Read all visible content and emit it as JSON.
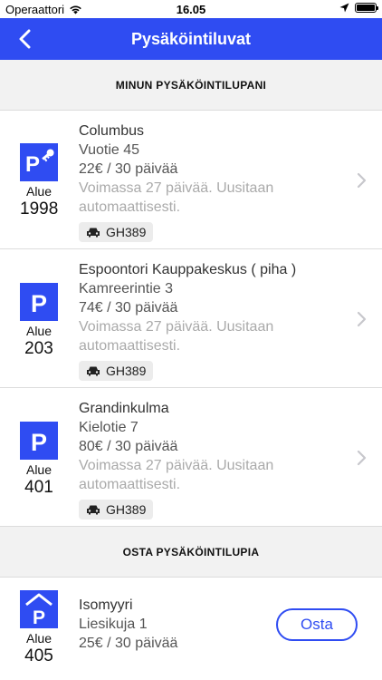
{
  "status_bar": {
    "carrier": "Operaattori",
    "time": "16.05"
  },
  "nav": {
    "title": "Pysäköintiluvat"
  },
  "colors": {
    "accent": "#2f4cf2"
  },
  "my_permits": {
    "header": "MINUN PYSÄKÖINTILUPANI",
    "items": [
      {
        "icon": "parking-key-icon",
        "zone_label": "Alue",
        "zone_number": "1998",
        "name": "Columbus",
        "address": "Vuotie 45",
        "price": "22€ / 30 päivää",
        "validity_1": "Voimassa 27 päivää. Uusitaan",
        "validity_2": "automaattisesti.",
        "plate": "GH389"
      },
      {
        "icon": "parking-icon",
        "zone_label": "Alue",
        "zone_number": "203",
        "name": "Espoontori Kauppakeskus ( piha )",
        "address": "Kamreerintie 3",
        "price": "74€ / 30 päivää",
        "validity_1": "Voimassa 27 päivää. Uusitaan",
        "validity_2": "automaattisesti.",
        "plate": "GH389"
      },
      {
        "icon": "parking-icon",
        "zone_label": "Alue",
        "zone_number": "401",
        "name": "Grandinkulma",
        "address": "Kielotie 7",
        "price": "80€ / 30 päivää",
        "validity_1": "Voimassa 27 päivää. Uusitaan",
        "validity_2": "automaattisesti.",
        "plate": "GH389"
      }
    ]
  },
  "buy_permits": {
    "header": "OSTA PYSÄKÖINTILUPIA",
    "items": [
      {
        "icon": "parking-garage-icon",
        "zone_label": "Alue",
        "zone_number": "405",
        "name": "Isomyyri",
        "address": "Liesikuja 1",
        "price": "25€ / 30 päivää",
        "buy_label": "Osta"
      }
    ]
  }
}
